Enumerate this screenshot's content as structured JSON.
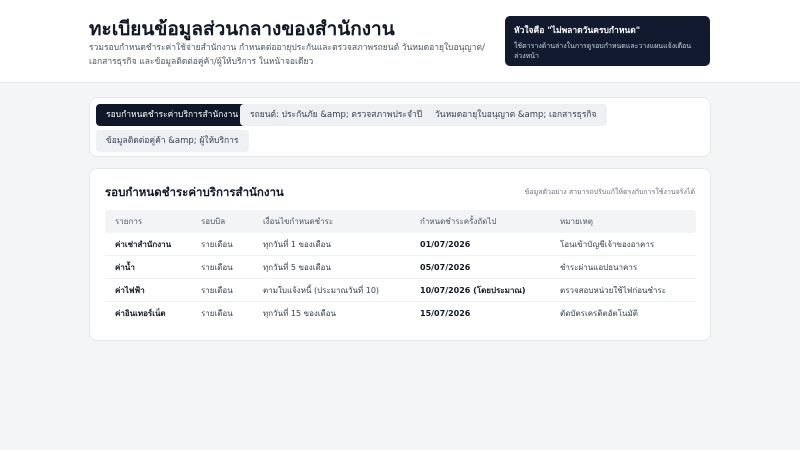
{
  "header": {
    "title": "ทะเบียนข้อมูลส่วนกลางของสำนักงาน",
    "subtitle": "รวมรอบกำหนดชำระค่าใช้จ่ายสำนักงาน กำหนดต่ออายุประกันและตรวจสภาพรถยนต์ วันหมดอายุใบอนุญาต/เอกสารธุรกิจ และข้อมูลติดต่อคู่ค้า/ผู้ให้บริการ ในหน้าจอเดียว"
  },
  "callout": {
    "title": "หัวใจคือ \"ไม่พลาดวันครบกำหนด\"",
    "text": "ใช้ตารางด้านล่างในการดูรอบกำหนดและวางแผนแจ้งเตือนล่วงหน้า"
  },
  "tabs": [
    {
      "label": "รอบกำหนดชำระค่าบริการสำนักงาน",
      "active": true
    },
    {
      "label": "รถยนต์: ประกันภัย &amp; ตรวจสภาพประจำปี",
      "active": false
    },
    {
      "label": "วันหมดอายุใบอนุญาต &amp; เอกสารธุรกิจ",
      "active": false
    },
    {
      "label": "ข้อมูลติดต่อคู่ค้า &amp; ผู้ให้บริการ",
      "active": false
    }
  ],
  "table": {
    "title": "รอบกำหนดชำระค่าบริการสำนักงาน",
    "note": "ข้อมูลตัวอย่าง สามารถปรับแก้ให้ตรงกับการใช้งานจริงได้",
    "headers": [
      "รายการ",
      "รอบบิล",
      "เงื่อนไขกำหนดชำระ",
      "กำหนดชำระครั้งถัดไป",
      "หมายเหตุ"
    ],
    "rows": [
      [
        "ค่าเช่าสำนักงาน",
        "รายเดือน",
        "ทุกวันที่ 1 ของเดือน",
        "01/07/2026",
        "โอนเข้าบัญชีเจ้าของอาคาร"
      ],
      [
        "ค่าน้ำ",
        "รายเดือน",
        "ทุกวันที่ 5 ของเดือน",
        "05/07/2026",
        "ชำระผ่านแอปธนาคาร"
      ],
      [
        "ค่าไฟฟ้า",
        "รายเดือน",
        "ตามใบแจ้งหนี้ (ประมาณวันที่ 10)",
        "10/07/2026 (โดยประมาณ)",
        "ตรวจสอบหน่วยใช้ไฟก่อนชำระ"
      ],
      [
        "ค่าอินเทอร์เน็ต",
        "รายเดือน",
        "ทุกวันที่ 15 ของเดือน",
        "15/07/2026",
        "ตัดบัตรเครดิตอัตโนมัติ"
      ]
    ]
  },
  "colors": {
    "accent_dark": "#0f1729",
    "callout_bg": "#111a2e",
    "page_bg": "#f4f5f7"
  }
}
